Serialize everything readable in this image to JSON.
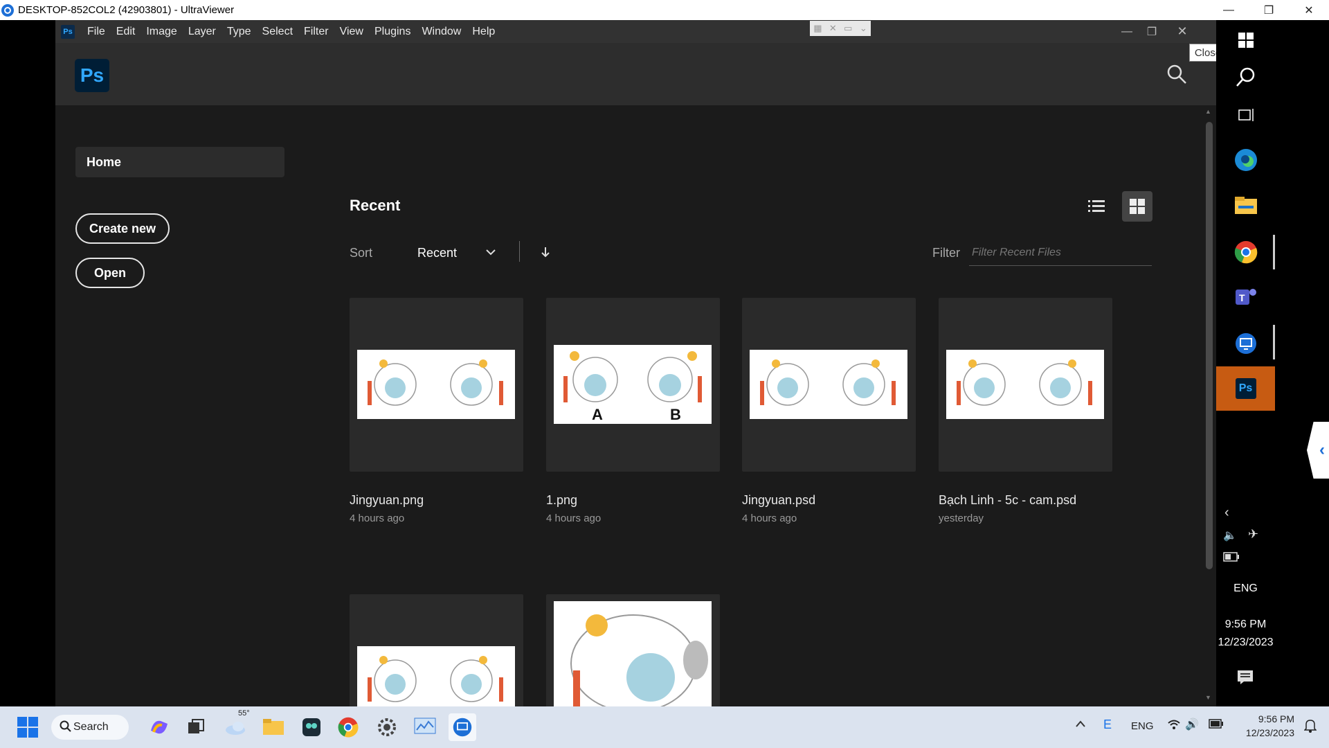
{
  "window": {
    "title": "DESKTOP-852COL2 (42903801) - UltraViewer"
  },
  "menu": [
    "File",
    "Edit",
    "Image",
    "Layer",
    "Type",
    "Select",
    "Filter",
    "View",
    "Plugins",
    "Window",
    "Help"
  ],
  "ps": {
    "logo": "Ps",
    "mini_logo": "Ps",
    "nav_home": "Home",
    "create_new": "Create new",
    "open": "Open",
    "recent_title": "Recent",
    "sort_label": "Sort",
    "sort_value": "Recent",
    "filter_label": "Filter",
    "filter_placeholder": "Filter Recent Files",
    "files": [
      {
        "name": "Jingyuan.png",
        "time": "4 hours ago"
      },
      {
        "name": "1.png",
        "time": "4 hours ago"
      },
      {
        "name": "Jingyuan.psd",
        "time": "4 hours ago"
      },
      {
        "name": "Bạch Linh - 5c - cam.psd",
        "time": "yesterday"
      }
    ],
    "thumb_labels": {
      "a": "A",
      "b": "B"
    }
  },
  "tooltip": "Close",
  "tray_side": {
    "lang": "ENG",
    "time": "9:56 PM",
    "date": "12/23/2023"
  },
  "taskbar": {
    "search_label": "Search",
    "weather": "55°",
    "lang": "ENG",
    "time": "9:56 PM",
    "date": "12/23/2023"
  },
  "colors": {
    "ps_blue": "#31a8ff",
    "ps_dark": "#001e36",
    "active_ps": "#c75b12"
  }
}
